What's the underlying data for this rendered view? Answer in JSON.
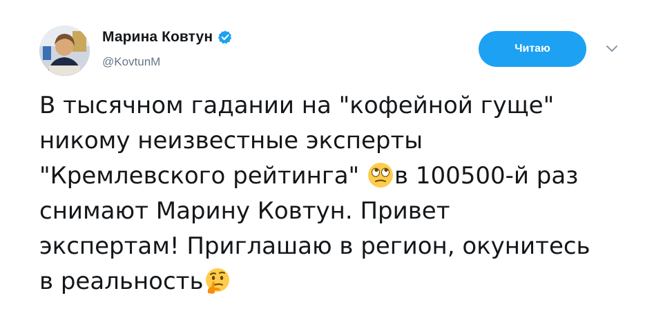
{
  "author": {
    "name": "Марина Ковтун",
    "handle": "@KovtunM",
    "verified": true,
    "avatar_icon": "avatar-photo"
  },
  "follow_button": {
    "label": "Читаю"
  },
  "menu_icon": "chevron-down-icon",
  "colors": {
    "accent": "#1da1f2",
    "text": "#14171a",
    "muted": "#657786"
  },
  "tweet": {
    "lines": [
      {
        "text": "В тысячном гадании на \"кофейной гуще\""
      },
      {
        "text": "никому неизвестные эксперты"
      },
      {
        "text_before": "\"Кремлевского рейтинга\" ",
        "emoji": "face-with-rolling-eyes",
        "text_after": "в 100500-й раз"
      },
      {
        "text": "снимают Марину Ковтун. Привет"
      },
      {
        "text": "экспертам! Приглашаю в регион, окунитесь"
      },
      {
        "text_before": "в реальность",
        "emoji": "thinking-face"
      }
    ]
  }
}
